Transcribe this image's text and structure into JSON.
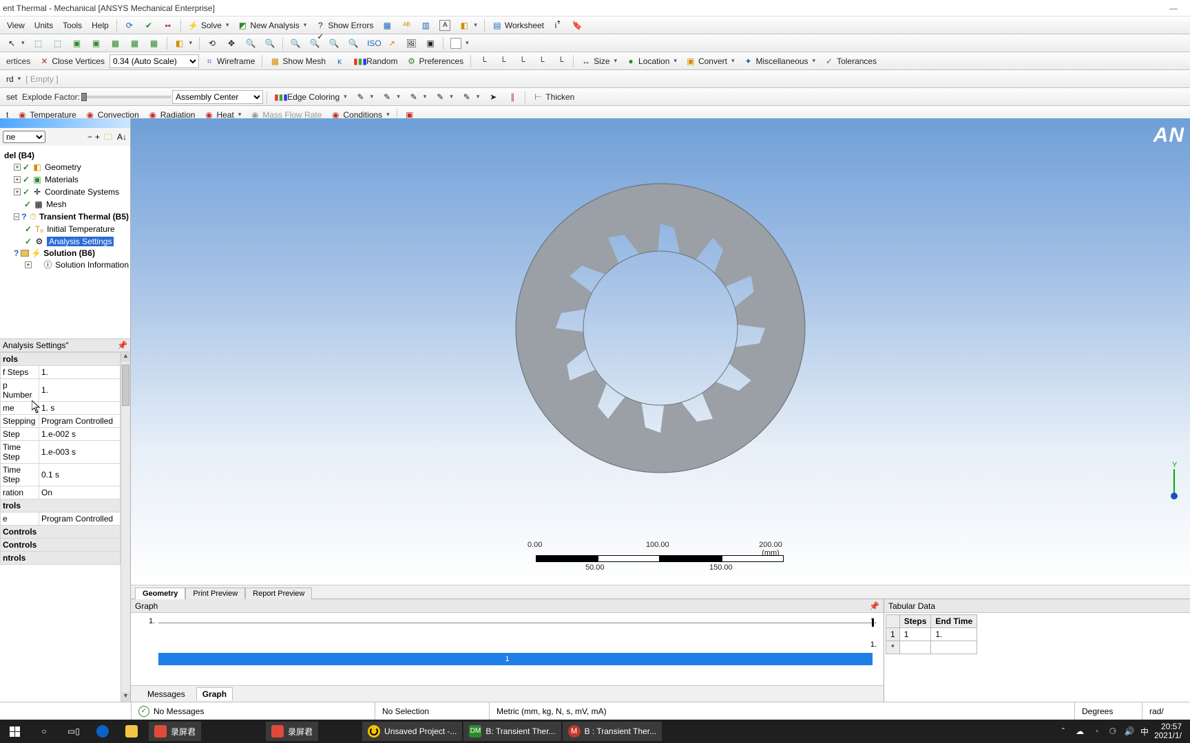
{
  "window": {
    "title": "ent Thermal - Mechanical [ANSYS Mechanical Enterprise]"
  },
  "menu": {
    "view": "View",
    "units": "Units",
    "tools": "Tools",
    "help": "Help",
    "solve": "Solve",
    "new_analysis": "New Analysis",
    "show_errors": "Show Errors",
    "worksheet": "Worksheet"
  },
  "tb2": {
    "close_vertices": "Close Vertices",
    "scale": "0.34 (Auto Scale)",
    "wireframe": "Wireframe",
    "show_mesh": "Show Mesh",
    "random": "Random",
    "preferences": "Preferences",
    "size": "Size",
    "location": "Location",
    "convert": "Convert",
    "miscellaneous": "Miscellaneous",
    "tolerances": "Tolerances"
  },
  "tb3": {
    "rd": "rd",
    "empty": "[ Empty ]"
  },
  "tb4": {
    "set": "set",
    "explode": "Explode Factor:",
    "assembly": "Assembly Center",
    "edge_coloring": "Edge Coloring",
    "thicken": "Thicken"
  },
  "tb5": {
    "t": "t",
    "temperature": "Temperature",
    "convection": "Convection",
    "radiation": "Radiation",
    "heat": "Heat",
    "mass_flow": "Mass Flow Rate",
    "conditions": "Conditions"
  },
  "tree": {
    "filter_value": "ne",
    "model": "del (B4)",
    "geometry": "Geometry",
    "materials": "Materials",
    "coord": "Coordinate Systems",
    "mesh": "Mesh",
    "transient": "Transient Thermal (B5)",
    "initial_temp": "Initial Temperature",
    "analysis_settings": "Analysis Settings",
    "solution": "Solution (B6)",
    "solution_info": "Solution Information"
  },
  "details": {
    "title": "Analysis Settings\"",
    "cat_step": "rols",
    "rows": [
      {
        "k": "f Steps",
        "v": "1."
      },
      {
        "k": "p Number",
        "v": "1."
      },
      {
        "k": "me",
        "v": "1. s"
      },
      {
        "k": "Stepping",
        "v": "Program Controlled"
      },
      {
        "k": " Step",
        "v": "1.e-002 s"
      },
      {
        "k": "Time Step",
        "v": "1.e-003 s"
      },
      {
        "k": "Time Step",
        "v": "0.1 s"
      },
      {
        "k": "ration",
        "v": "On"
      }
    ],
    "cat2": "trols",
    "row2": {
      "k": "e",
      "v": "Program Controlled"
    },
    "cat3": "Controls",
    "cat4": "Controls",
    "cat5": "ntrols"
  },
  "viewport": {
    "brand": "AN",
    "scale": {
      "t0": "0.00",
      "t1": "100.00",
      "t2": "200.00 (mm)",
      "b0": "50.00",
      "b1": "150.00"
    },
    "triad_y": "Y"
  },
  "view_tabs": {
    "geometry": "Geometry",
    "print": "Print Preview",
    "report": "Report Preview"
  },
  "graph": {
    "title": "Graph",
    "y1": "1.",
    "y2": "1.",
    "y3": "1.",
    "xl": "1",
    "tabs": {
      "messages": "Messages",
      "graph": "Graph"
    }
  },
  "tabular": {
    "title": "Tabular Data",
    "cols": {
      "steps": "Steps",
      "end": "End Time"
    },
    "row1": {
      "idx": "1",
      "steps": "1",
      "end": "1."
    },
    "star": "*"
  },
  "status": {
    "no_messages": "No Messages",
    "no_selection": "No Selection",
    "metric": "Metric (mm, kg, N, s, mV, mA)",
    "degrees": "Degrees",
    "rad": "rad/"
  },
  "taskbar": {
    "rec1": "录屏君",
    "rec2": "录屏君",
    "unsaved": "Unsaved Project -...",
    "dm": "B: Transient Ther...",
    "m": "B : Transient Ther...",
    "ime": "中",
    "time": "20:57",
    "date": "2021/1/"
  }
}
